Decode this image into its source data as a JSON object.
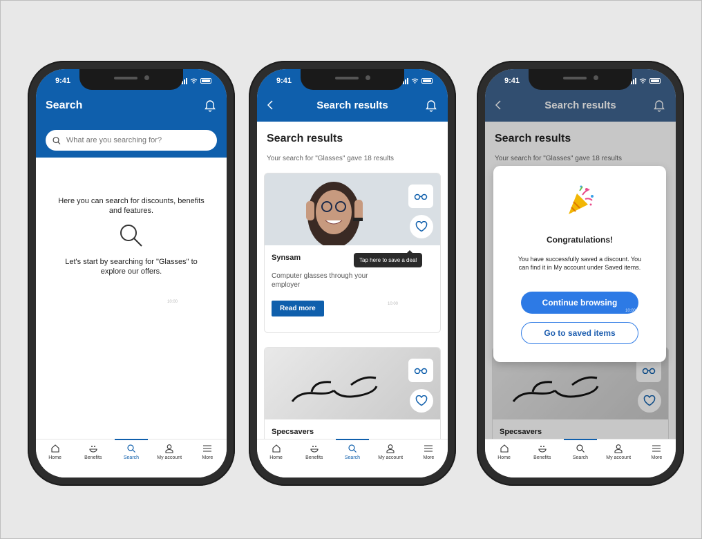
{
  "status_time": "9:41",
  "ghost_time": "10:00",
  "phone1": {
    "title": "Search",
    "search_placeholder": "What are you searching for?",
    "empty_line1": "Here you can search for discounts, benefits and features.",
    "empty_line2": "Let's start by searching for \"Glasses\" to explore our offers."
  },
  "results": {
    "appbar_title": "Search results",
    "heading": "Search results",
    "summary": "Your search for \"Glasses\" gave 18 results",
    "card1": {
      "title": "Synsam",
      "description": "Computer glasses through your employer",
      "button": "Read more",
      "tooltip": "Tap here to save a deal"
    },
    "card2": {
      "title": "Specsavers"
    }
  },
  "modal": {
    "title": "Congratulations!",
    "body": "You have successfully saved a discount. You can find it in My account under Saved items.",
    "primary": "Continue browsing",
    "secondary": "Go to saved items"
  },
  "nav": [
    "Home",
    "Benefits",
    "Search",
    "My account",
    "More"
  ],
  "colors": {
    "brand": "#0f5fac",
    "accent": "#2d7ae5"
  }
}
